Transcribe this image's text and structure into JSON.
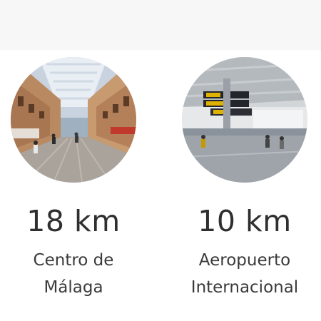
{
  "destinations": [
    {
      "distance": "18 km",
      "name_line1": "Centro de",
      "name_line2": "Málaga",
      "image": "street-photo"
    },
    {
      "distance": "10 km",
      "name_line1": "Aeropuerto",
      "name_line2": "Internacional",
      "image": "airport-terminal-photo"
    }
  ]
}
